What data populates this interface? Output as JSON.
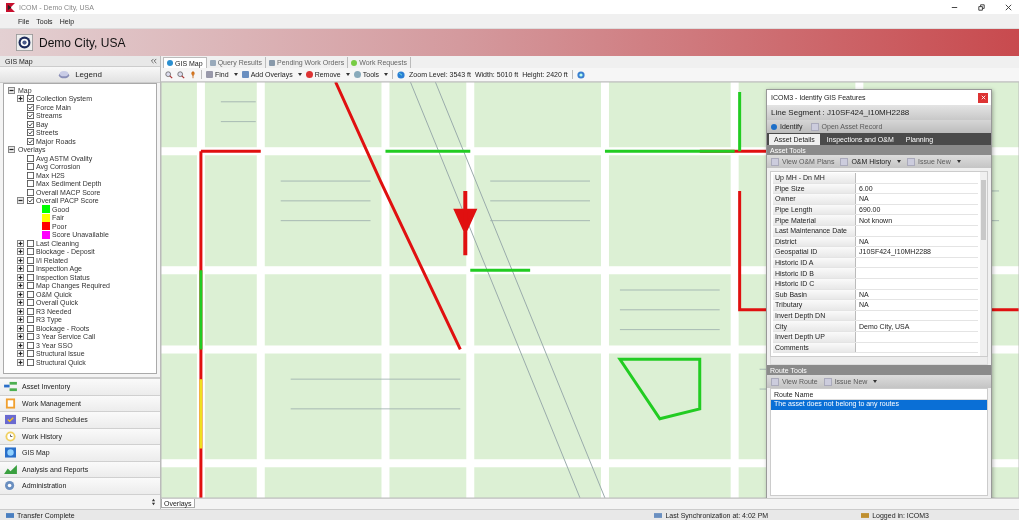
{
  "window": {
    "title": "ICOM - Demo City, USA"
  },
  "menu": [
    "File",
    "Tools",
    "Help"
  ],
  "banner": {
    "title": "Demo City, USA"
  },
  "sidebar": {
    "title": "GIS Map",
    "legend_button": "Legend",
    "tree": [
      {
        "label": "Map",
        "expanded": true,
        "children": [
          {
            "label": "Collection System",
            "expanded": false,
            "checked": true
          },
          {
            "label": "Force Main",
            "checked": true
          },
          {
            "label": "Streams",
            "checked": true
          },
          {
            "label": "Bay",
            "checked": true
          },
          {
            "label": "Streets",
            "checked": true
          },
          {
            "label": "Major Roads",
            "checked": true
          }
        ]
      },
      {
        "label": "Overlays",
        "expanded": true,
        "children": [
          {
            "label": "Avg ASTM Ovality",
            "checked": false
          },
          {
            "label": "Avg Corrosion",
            "checked": false
          },
          {
            "label": "Max H2S",
            "checked": false
          },
          {
            "label": "Max Sediment Depth",
            "checked": false
          },
          {
            "label": "Overall MACP Score",
            "checked": false
          },
          {
            "label": "Overall PACP Score",
            "expanded": true,
            "checked": true,
            "children": [
              {
                "kind": "swatch",
                "label": "Good",
                "color": "#00ff00"
              },
              {
                "kind": "swatch",
                "label": "Fair",
                "color": "#ffff00"
              },
              {
                "kind": "swatch",
                "label": "Poor",
                "color": "#ff0000"
              },
              {
                "kind": "swatch",
                "label": "Score Unavailable",
                "color": "#ff00ff"
              }
            ]
          },
          {
            "label": "Last Cleaning",
            "expanded": false,
            "checked": false
          },
          {
            "label": "Blockage - Deposit",
            "expanded": false,
            "checked": false
          },
          {
            "label": "I/I Related",
            "expanded": false,
            "checked": false
          },
          {
            "label": "Inspection Age",
            "expanded": false,
            "checked": false
          },
          {
            "label": "Inspection Status",
            "expanded": false,
            "checked": false
          },
          {
            "label": "Map Changes Required",
            "expanded": false,
            "checked": false
          },
          {
            "label": "O&M Quick",
            "expanded": false,
            "checked": false
          },
          {
            "label": "Overall Quick",
            "expanded": false,
            "checked": false
          },
          {
            "label": "R3 Needed",
            "expanded": false,
            "checked": false
          },
          {
            "label": "R3 Type",
            "expanded": false,
            "checked": false
          },
          {
            "label": "Blockage - Roots",
            "expanded": false,
            "checked": false
          },
          {
            "label": "3 Year Service Call",
            "expanded": false,
            "checked": false
          },
          {
            "label": "3 Year SSO",
            "expanded": false,
            "checked": false
          },
          {
            "label": "Structural Issue",
            "expanded": false,
            "checked": false
          },
          {
            "label": "Structural Quick",
            "expanded": false,
            "checked": false
          }
        ]
      }
    ],
    "nav": [
      "Asset Inventory",
      "Work Management",
      "Plans and Schedules",
      "Work History",
      "GIS Map",
      "Analysis and Reports",
      "Administration"
    ]
  },
  "tabs": [
    {
      "label": "GIS Map",
      "selected": true
    },
    {
      "label": "Query Results",
      "selected": false
    },
    {
      "label": "Pending Work Orders",
      "selected": false
    },
    {
      "label": "Work Requests",
      "selected": false
    }
  ],
  "toolbar": {
    "buttons": [
      "Find",
      "Add Overlays",
      "Remove",
      "Tools"
    ],
    "zoom_level": "Zoom Level: 3543 ft",
    "width": "Width: 5010 ft",
    "height": "Height: 2420 ft"
  },
  "overlays_tab": "Overlays",
  "dialog": {
    "title": "ICOM3 - Identify GIS Features",
    "heading": "Line Segment : J10SF424_I10MH2288",
    "actions": [
      {
        "label": "Identify",
        "disabled": false
      },
      {
        "label": "Open Asset Record",
        "disabled": true
      }
    ],
    "tabs": [
      {
        "label": "Asset Details",
        "selected": true
      },
      {
        "label": "Inspections and O&M",
        "selected": false
      },
      {
        "label": "Planning",
        "selected": false
      }
    ],
    "asset_tools": {
      "title": "Asset Tools",
      "buttons": [
        {
          "label": "View O&M Plans",
          "disabled": true,
          "dropdown": false
        },
        {
          "label": "O&M History",
          "disabled": false,
          "dropdown": true
        },
        {
          "label": "Issue New",
          "disabled": true,
          "dropdown": true
        }
      ]
    },
    "properties": [
      {
        "label": "Up MH - Dn MH"
      },
      {
        "label": "Pipe Size",
        "value": "6.00"
      },
      {
        "label": "Owner",
        "value": "NA"
      },
      {
        "label": "Pipe Length",
        "value": "690.00"
      },
      {
        "label": "Pipe Material",
        "value": "Not known"
      },
      {
        "label": "Last Maintenance Date"
      },
      {
        "label": "District",
        "value": "NA"
      },
      {
        "label": "Geospatial ID",
        "value": "J10SF424_I10MH2288"
      },
      {
        "label": "Historic ID A"
      },
      {
        "label": "Historic ID B"
      },
      {
        "label": "Historic ID C"
      },
      {
        "label": "Sub Basin",
        "value": "NA"
      },
      {
        "label": "Tributary",
        "value": "NA"
      },
      {
        "label": "Invert Depth DN"
      },
      {
        "label": "City",
        "value": "Demo City, USA"
      },
      {
        "label": "Invert Depth UP"
      },
      {
        "label": "Comments"
      }
    ],
    "route_tools": {
      "title": "Route Tools",
      "buttons": [
        {
          "label": "View Route",
          "disabled": true,
          "dropdown": false
        },
        {
          "label": "Issue New",
          "disabled": true,
          "dropdown": true
        }
      ]
    },
    "routes": {
      "columns": [
        "Route Name"
      ],
      "rows": [
        {
          "cells": [
            "The asset does not belong to any routes"
          ],
          "selected": true
        }
      ]
    }
  },
  "status_bar": {
    "message": "Transfer Complete",
    "sync": "Last Synchronization at: 4:02 PM",
    "user": "Logged in: ICOM3"
  }
}
